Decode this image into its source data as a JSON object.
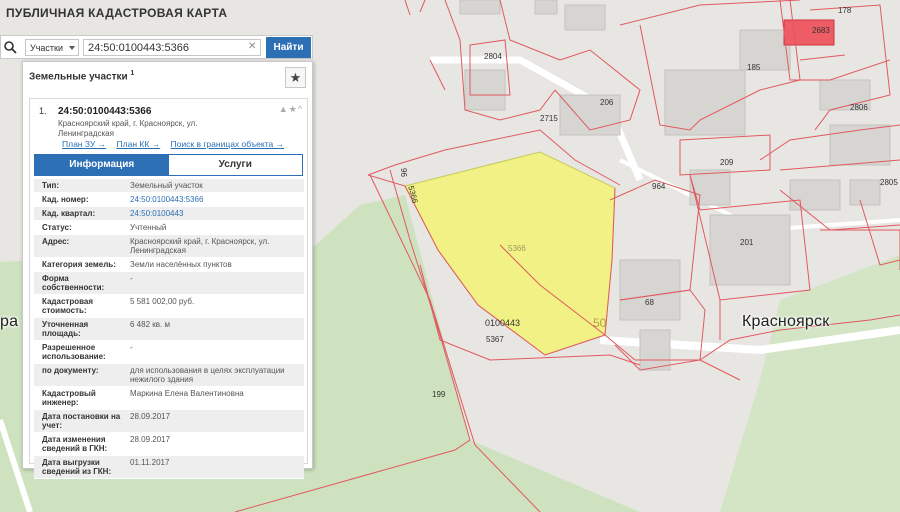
{
  "app": {
    "title": "ПУБЛИЧНАЯ КАДАСТРОВАЯ КАРТА"
  },
  "search": {
    "type_label": "Участки",
    "query": "24:50:0100443:5366",
    "find_label": "Найти"
  },
  "panel": {
    "header": "Земельные участки",
    "header_count": "1",
    "card": {
      "num": "1.",
      "title": "24:50:0100443:5366",
      "address": "Красноярский край, г. Красноярск, ул. Ленинградская",
      "tools": "▲★^",
      "links": [
        "План ЗУ →",
        "План КК →",
        "Поиск в границах объекта →"
      ]
    },
    "tabs": [
      "Информация",
      "Услуги"
    ],
    "info": [
      {
        "key": "Тип:",
        "value": "Земельный участок"
      },
      {
        "key": "Кад. номер:",
        "value": "24:50:0100443:5366",
        "link": true
      },
      {
        "key": "Кад. квартал:",
        "value": "24:50:0100443",
        "link": true
      },
      {
        "key": "Статус:",
        "value": "Учтенный"
      },
      {
        "key": "Адрес:",
        "value": "Красноярский край, г. Красноярск, ул. Ленинградская"
      },
      {
        "key": "Категория земель:",
        "value": "Земли населённых пунктов"
      },
      {
        "key": "Форма собственности:",
        "value": "-"
      },
      {
        "key": "Кадастровая стоимость:",
        "value": "5 581 002,00 руб."
      },
      {
        "key": "Уточненная площадь:",
        "value": "6 482 кв. м"
      },
      {
        "key": "Разрешенное использование:",
        "value": "-"
      },
      {
        "key": "по документу:",
        "value": "для использования в целях эксплуатации нежилого здания"
      },
      {
        "key": "Кадастровый инженер:",
        "value": "Маркина Елена Валентиновна"
      },
      {
        "key": "Дата постановки на учет:",
        "value": "28.09.2017"
      },
      {
        "key": "Дата изменения сведений в ГКН:",
        "value": "28.09.2017"
      },
      {
        "key": "Дата выгрузки сведений из ГКН:",
        "value": "01.11.2017"
      }
    ]
  },
  "map": {
    "city_label": "Красноярск",
    "city_label_left": "ра",
    "parcel_labels": [
      "2804",
      "185",
      "206",
      "2715",
      "2683",
      "178",
      "2806",
      "209",
      "964",
      "2805",
      "201",
      "68",
      "5366",
      "0100443",
      "50",
      "5367",
      "199",
      "96",
      "5366"
    ],
    "colors": {
      "selected_fill": "#f2f27a",
      "boundary": "#e0595f",
      "green": "#cfe2c0",
      "road": "#ffffff"
    }
  }
}
